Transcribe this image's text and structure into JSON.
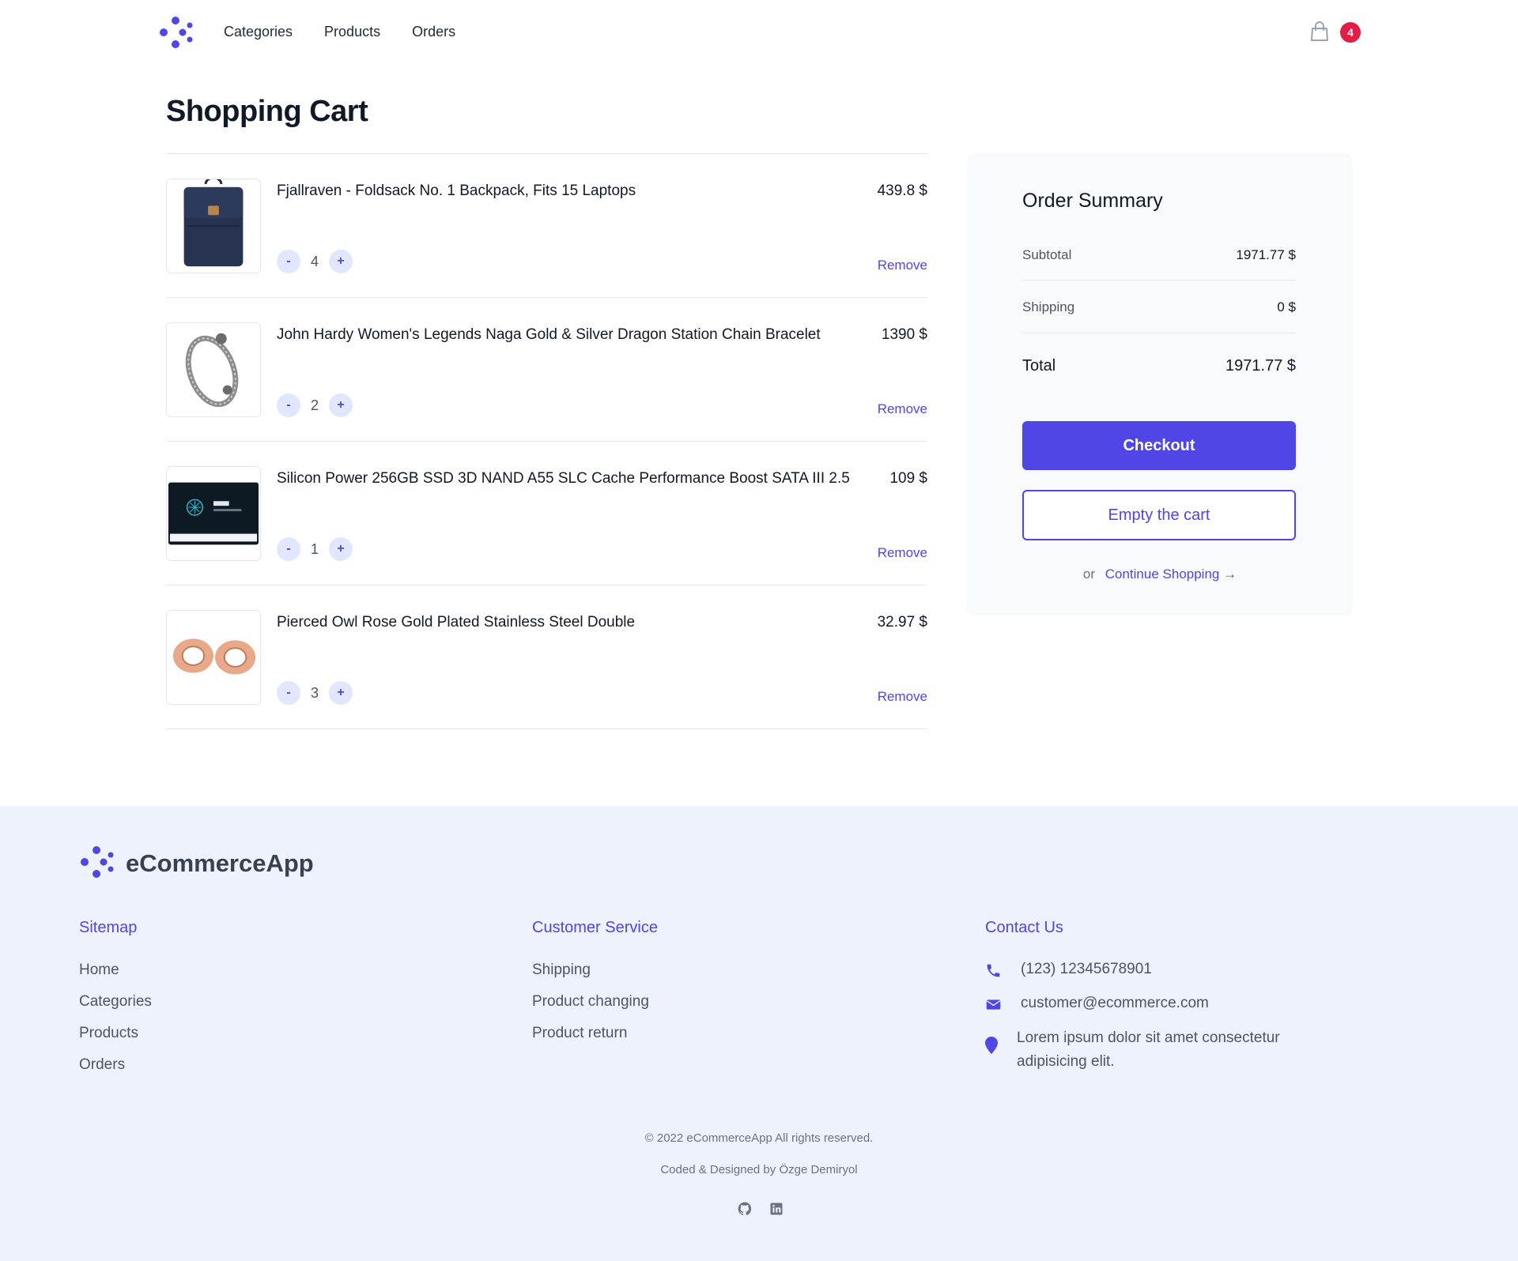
{
  "header": {
    "nav": [
      "Categories",
      "Products",
      "Orders"
    ],
    "cart_count": "4"
  },
  "cart": {
    "title": "Shopping Cart",
    "items": [
      {
        "name": "Fjallraven - Foldsack No. 1 Backpack, Fits 15 Laptops",
        "price": "439.8 $",
        "qty": "4",
        "remove": "Remove",
        "image": "backpack"
      },
      {
        "name": "John Hardy Women's Legends Naga Gold & Silver Dragon Station Chain Bracelet",
        "price": "1390 $",
        "qty": "2",
        "remove": "Remove",
        "image": "bracelet"
      },
      {
        "name": "Silicon Power 256GB SSD 3D NAND A55 SLC Cache Performance Boost SATA III 2.5",
        "price": "109 $",
        "qty": "1",
        "remove": "Remove",
        "image": "ssd"
      },
      {
        "name": "Pierced Owl Rose Gold Plated Stainless Steel Double",
        "price": "32.97 $",
        "qty": "3",
        "remove": "Remove",
        "image": "earrings"
      }
    ],
    "minus_label": "-",
    "plus_label": "+"
  },
  "summary": {
    "title": "Order Summary",
    "subtotal_label": "Subtotal",
    "subtotal_value": "1971.77 $",
    "shipping_label": "Shipping",
    "shipping_value": "0 $",
    "total_label": "Total",
    "total_value": "1971.77 $",
    "checkout_label": "Checkout",
    "empty_label": "Empty the cart",
    "or_text": "or",
    "continue_label": "Continue Shopping →"
  },
  "footer": {
    "brand": "eCommerceApp",
    "sitemap": {
      "title": "Sitemap",
      "links": [
        "Home",
        "Categories",
        "Products",
        "Orders"
      ]
    },
    "service": {
      "title": "Customer Service",
      "links": [
        "Shipping",
        "Product changing",
        "Product return"
      ]
    },
    "contact": {
      "title": "Contact Us",
      "phone": "(123) 12345678901",
      "email": "customer@ecommerce.com",
      "address": "Lorem ipsum dolor sit amet consectetur adipisicing elit."
    },
    "copyright": "© 2022 eCommerceApp All rights reserved.",
    "credits": "Coded & Designed by Özge Demiryol",
    "social_icons": [
      "github-icon",
      "linkedin-icon"
    ]
  },
  "colors": {
    "accent": "#4f46e5",
    "badge": "#e11d48",
    "footer_bg": "#eef2fd",
    "summary_bg": "#f9fafb"
  }
}
